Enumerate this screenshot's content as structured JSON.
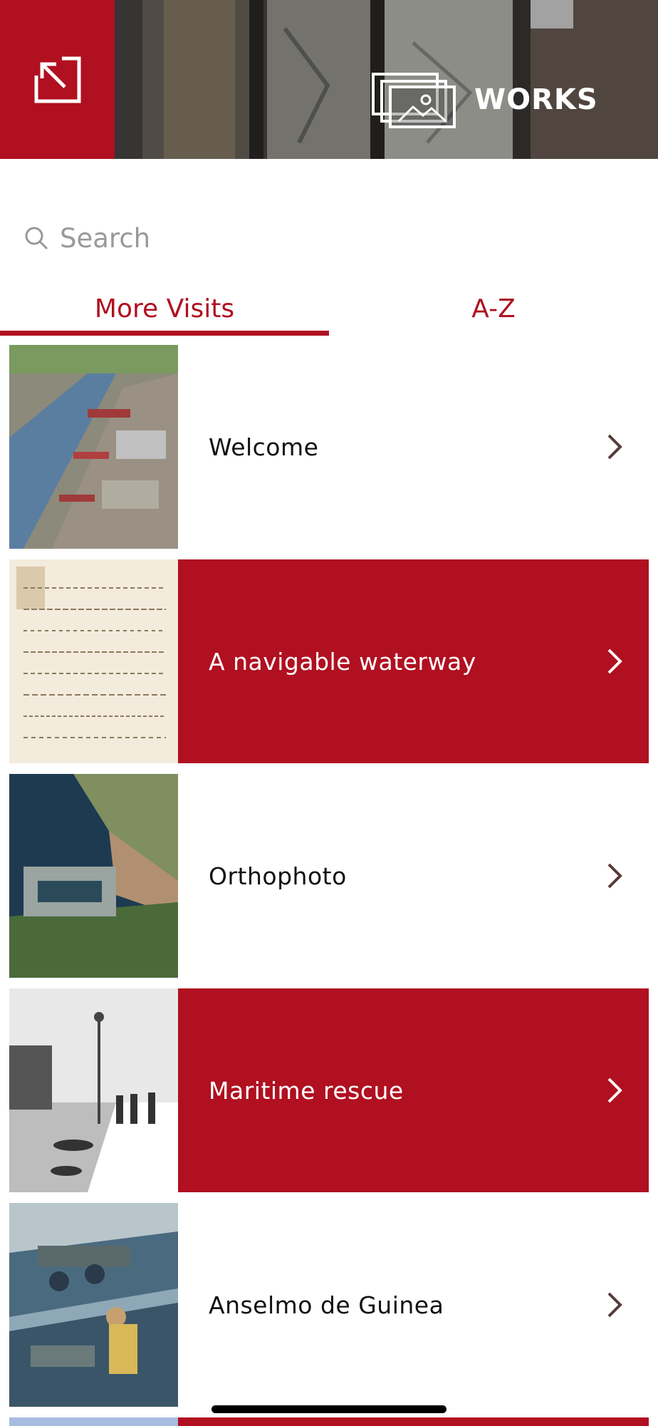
{
  "header": {
    "title": "WORKS",
    "back_icon": "arrow-up-left-in-box-icon",
    "works_icon": "image-gallery-icon",
    "accent_color": "#b01020"
  },
  "search": {
    "placeholder": "Search",
    "value": ""
  },
  "tabs": [
    {
      "label": "More Visits",
      "selected": true
    },
    {
      "label": "A-Z",
      "selected": false
    }
  ],
  "list": {
    "items": [
      {
        "label": "Welcome",
        "style": "white",
        "thumb": "aerial-harbor-photo"
      },
      {
        "label": "A navigable waterway",
        "style": "red",
        "thumb": "old-manuscript"
      },
      {
        "label": "Orthophoto",
        "style": "white",
        "thumb": "satellite-port-photo"
      },
      {
        "label": "Maritime rescue",
        "style": "red",
        "thumb": "bw-dock-photo"
      },
      {
        "label": "Anselmo de Guinea",
        "style": "white",
        "thumb": "sea-rescue-painting"
      }
    ]
  }
}
